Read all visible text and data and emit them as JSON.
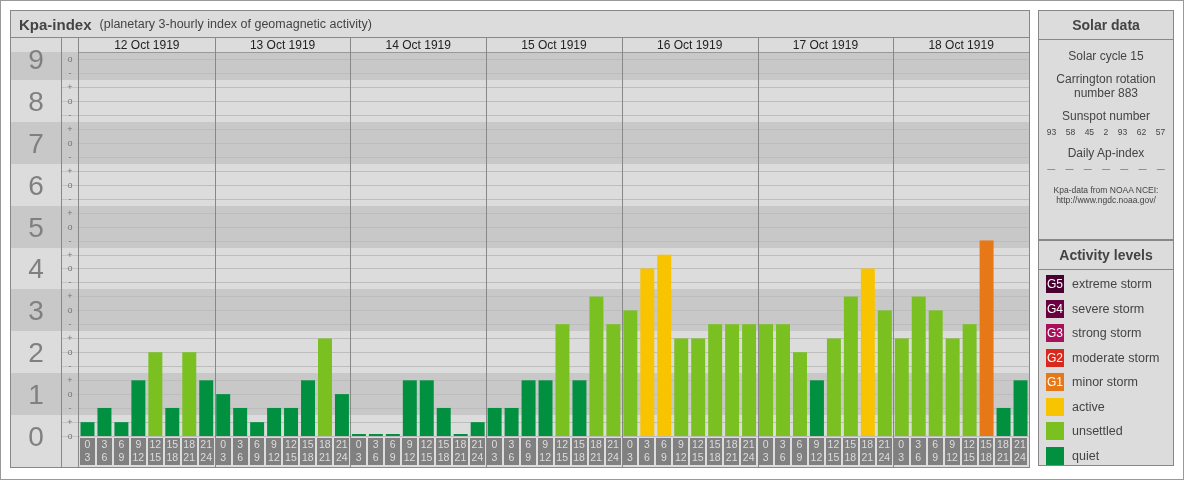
{
  "kp_panel": {
    "title": "Kpa-index",
    "subtitle": "(planetary 3-hourly index of geomagnetic activity)",
    "days": [
      "12 Oct 1919",
      "13 Oct 1919",
      "14 Oct 1919",
      "15 Oct 1919",
      "16 Oct 1919",
      "17 Oct 1919",
      "18 Oct 1919"
    ],
    "sub_axis_labels": [
      "o",
      "-",
      "+",
      "o",
      "-",
      "+",
      "o",
      "-",
      "+",
      "o",
      "-",
      "+",
      "o",
      "-",
      "+",
      "o",
      "-",
      "+",
      "o",
      "-",
      "+",
      "o",
      "-",
      "+",
      "o",
      "-",
      "+",
      "o"
    ],
    "chart_data": {
      "type": "bar",
      "ylim": [
        0,
        9.17
      ],
      "grid": true,
      "categories": [
        "0 3",
        "3 6",
        "6 9",
        "9 12",
        "12 15",
        "15 18",
        "18 21",
        "21 24",
        "0 3",
        "3 6",
        "6 9",
        "9 12",
        "12 15",
        "15 18",
        "18 21",
        "21 24",
        "0 3",
        "3 6",
        "6 9",
        "9 12",
        "12 15",
        "15 18",
        "18 21",
        "21 24",
        "0 3",
        "3 6",
        "6 9",
        "9 12",
        "12 15",
        "15 18",
        "18 21",
        "21 24",
        "0 3",
        "3 6",
        "6 9",
        "9 12",
        "12 15",
        "15 18",
        "18 21",
        "21 24",
        "0 3",
        "3 6",
        "6 9",
        "9 12",
        "12 15",
        "15 18",
        "18 21",
        "21 24",
        "0 3",
        "3 6",
        "6 9",
        "9 12",
        "12 15",
        "15 18",
        "18 21",
        "21 24"
      ],
      "values": [
        0.33,
        0.67,
        0.33,
        1.33,
        2,
        0.67,
        2,
        1.33,
        1,
        0.67,
        0.33,
        0.67,
        0.67,
        1.33,
        2.33,
        1,
        0,
        0,
        0,
        1.33,
        1.33,
        0.67,
        0,
        0.33,
        0.67,
        0.67,
        1.33,
        1.33,
        2.67,
        1.33,
        3.33,
        2.67,
        3,
        4,
        4.33,
        2.33,
        2.33,
        2.67,
        2.67,
        2.67,
        2.67,
        2.67,
        2,
        1.33,
        2.33,
        3.33,
        4,
        3,
        2.33,
        3.33,
        3,
        2.33,
        2.67,
        4.67,
        0.67,
        1.33
      ],
      "yticks": [
        {
          "value": 9,
          "label": "9"
        },
        {
          "value": 8,
          "label": "8"
        },
        {
          "value": 7,
          "label": "7"
        },
        {
          "value": 6,
          "label": "6"
        },
        {
          "value": 5,
          "label": "5"
        },
        {
          "value": 4,
          "label": "4"
        },
        {
          "value": 3,
          "label": "3"
        },
        {
          "value": 2,
          "label": "2"
        },
        {
          "value": 1,
          "label": "1"
        },
        {
          "value": 0,
          "label": "0"
        }
      ]
    }
  },
  "solar_data": {
    "title": "Solar data",
    "solar_cycle": "Solar cycle 15",
    "carrington_rotation": "Carrington rotation number 883",
    "sunspot_label": "Sunspot number",
    "sunspot_numbers": [
      "93",
      "58",
      "45",
      "2",
      "93",
      "62",
      "57"
    ],
    "ap_label": "Daily Ap-index",
    "ap_values": [
      "—",
      "—",
      "—",
      "—",
      "—",
      "—",
      "—"
    ],
    "source": "Kpa-data from NOAA NCEI:",
    "source_url": "http://www.ngdc.noaa.gov/"
  },
  "activity_levels": {
    "title": "Activity levels",
    "items": [
      {
        "code": "G5",
        "label": "extreme storm",
        "color": "#4a0030"
      },
      {
        "code": "G4",
        "label": "severe storm",
        "color": "#6a0040"
      },
      {
        "code": "G3",
        "label": "strong storm",
        "color": "#a8105c"
      },
      {
        "code": "G2",
        "label": "moderate storm",
        "color": "#d82a1c"
      },
      {
        "code": "G1",
        "label": "minor storm",
        "color": "#e67817"
      },
      {
        "label": "active",
        "color": "#f8c400"
      },
      {
        "label": "unsettled",
        "color": "#7ac020"
      },
      {
        "label": "quiet",
        "color": "#009040"
      }
    ]
  }
}
